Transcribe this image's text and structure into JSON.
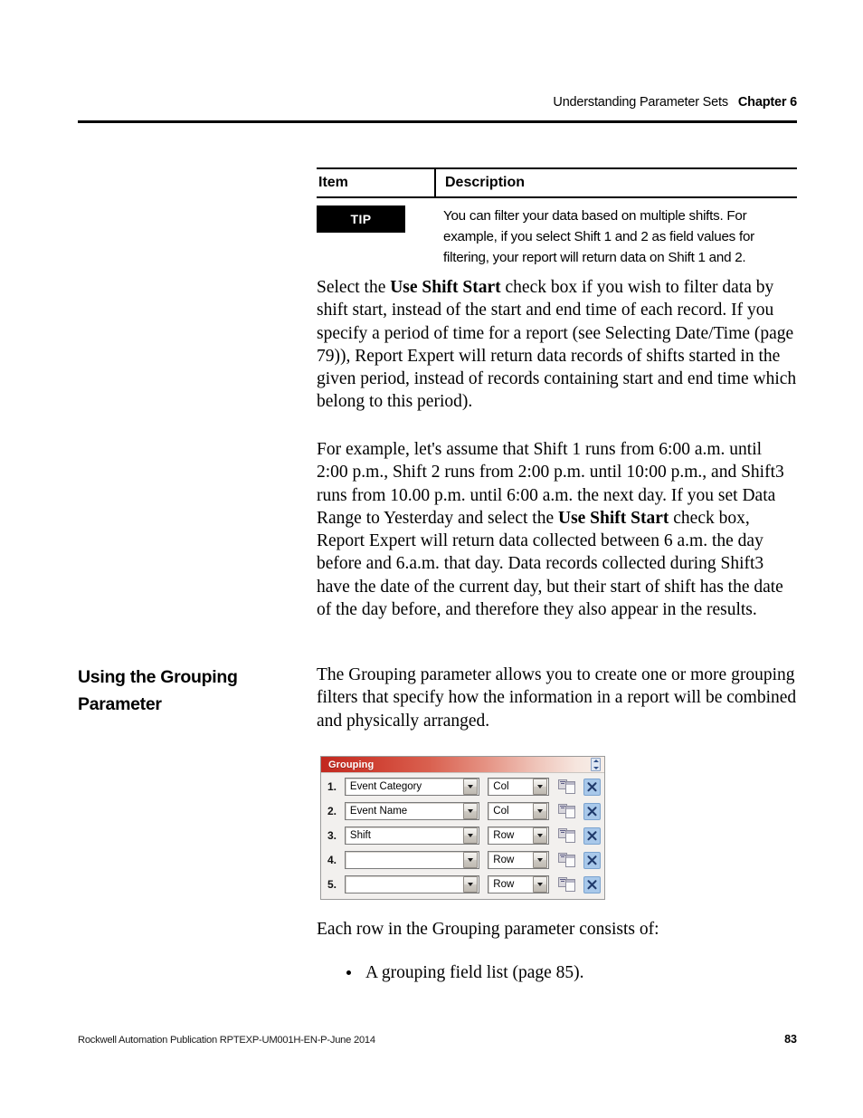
{
  "header": {
    "running_title": "Understanding Parameter Sets",
    "chapter": "Chapter 6"
  },
  "table": {
    "columns": [
      "Item",
      "Description"
    ],
    "rows": [
      {
        "item_badge": "TIP",
        "description": "You can filter your data based on multiple shifts. For example, if you select Shift 1 and 2 as field values for filtering, your report will return data on Shift 1 and 2."
      }
    ]
  },
  "body": {
    "para1_a": "Select the ",
    "para1_b": "Use Shift Start",
    "para1_c": " check box if you wish to filter data by shift start, instead of the start and end time of each record. If you specify a period of time for a report (see Selecting Date/Time (page 79)), Report Expert will return data records of shifts started in the given period, instead of records containing start and end time which belong to this period).",
    "para2_a": "For example, let's assume that Shift 1 runs from 6:00 a.m. until 2:00 p.m., Shift 2 runs from 2:00 p.m. until 10:00 p.m., and Shift3 runs from 10.00 p.m. until 6:00 a.m. the next day. If you set Data Range to Yesterday and select the ",
    "para2_b": "Use Shift Start",
    "para2_c": " check box, Report Expert will return data collected between 6 a.m. the day before and 6.a.m. that day. Data records collected during Shift3 have the date of the current day, but their start of shift has the date of the day before, and therefore they also appear in the results.",
    "para3": "The Grouping parameter allows you to create one or more grouping filters that specify how the information in a report will be combined and physically arranged.",
    "para4": "Each row in the Grouping parameter consists of:"
  },
  "section": {
    "heading_line1": "Using the Grouping",
    "heading_line2": "Parameter"
  },
  "bullets": [
    "A grouping field list (page 85)."
  ],
  "grouping_panel": {
    "title": "Grouping",
    "title_gradient_start": "#c2281f",
    "title_gradient_end": "#f7efe9",
    "delete_button_color": "#a8c8ea",
    "rows": [
      {
        "number": "1.",
        "field": "Event Category",
        "placement": "Col"
      },
      {
        "number": "2.",
        "field": "Event Name",
        "placement": "Col"
      },
      {
        "number": "3.",
        "field": "Shift",
        "placement": "Row"
      },
      {
        "number": "4.",
        "field": "",
        "placement": "Row"
      },
      {
        "number": "5.",
        "field": "",
        "placement": "Row"
      }
    ]
  },
  "footer": {
    "publication": "Rockwell Automation Publication RPTEXP-UM001H-EN-P-June 2014",
    "page_number": "83"
  }
}
